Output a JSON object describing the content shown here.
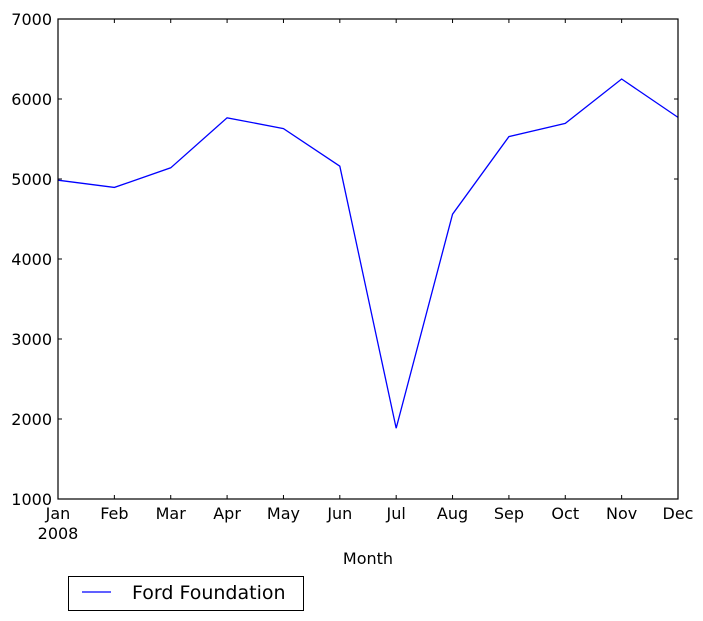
{
  "chart_data": {
    "type": "line",
    "title": "",
    "xlabel": "Month",
    "ylabel": "",
    "categories": [
      "Jan",
      "Feb",
      "Mar",
      "Apr",
      "May",
      "Jun",
      "Jul",
      "Aug",
      "Sep",
      "Oct",
      "Nov",
      "Dec"
    ],
    "x_sublabel": "2008",
    "series": [
      {
        "name": "Ford Foundation",
        "color": "#0000ff",
        "values": [
          4985,
          4895,
          5140,
          5765,
          5630,
          5160,
          1885,
          4560,
          5530,
          5695,
          6250,
          5770
        ]
      }
    ],
    "ylim": [
      1000,
      7000
    ],
    "yticks": [
      1000,
      2000,
      3000,
      4000,
      5000,
      6000,
      7000
    ],
    "ytick_labels": [
      "1000",
      "2000",
      "3000",
      "4000",
      "5000",
      "6000",
      "7000"
    ],
    "grid": false,
    "legend": {
      "position": "bottom-left-outside",
      "entries": [
        "Ford Foundation"
      ]
    }
  }
}
